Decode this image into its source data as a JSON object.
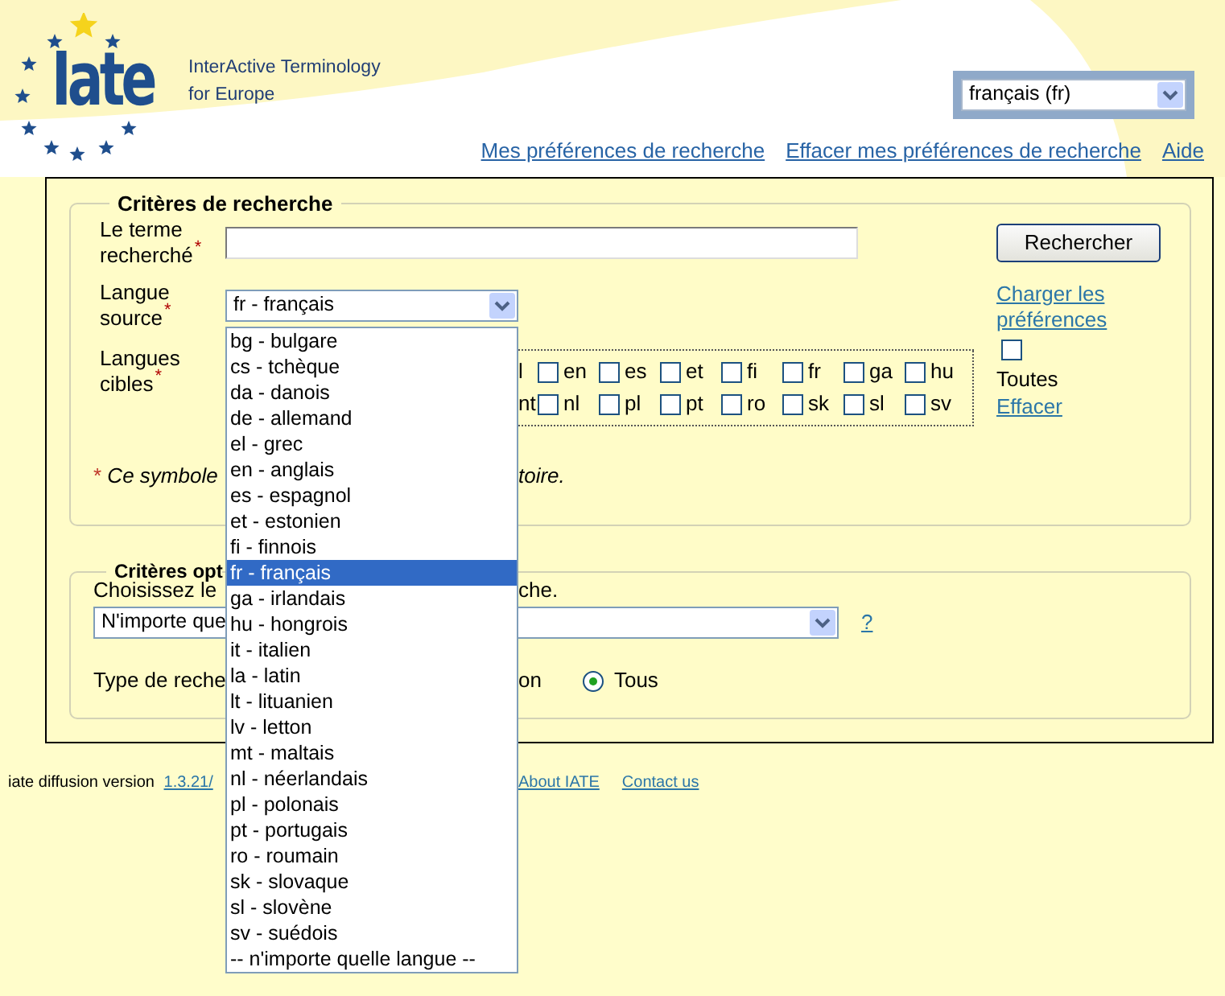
{
  "logo": {
    "mark": "Iate",
    "name_lines": [
      "InterActive Terminology",
      "for Europe"
    ]
  },
  "interface_language": {
    "value": "français (fr)"
  },
  "top_links": [
    "Mes préférences de recherche",
    "Effacer mes préférences de recherche",
    "Aide"
  ],
  "search_criteria": {
    "legend": "Critères de recherche",
    "term": {
      "label": "Le terme recherché",
      "mark": "*"
    },
    "search_button": "Rechercher",
    "source": {
      "label": "Langue source",
      "mark": "*",
      "value": "fr - français"
    },
    "load_link": "Charger les préférences",
    "targets": {
      "label": "Langues cibles",
      "mark": "*",
      "rows": [
        [
          {
            "kind": "text",
            "label": "l"
          },
          {
            "kind": "checkbox",
            "label": "en",
            "checked": false
          },
          {
            "kind": "checkbox",
            "label": "es",
            "checked": false
          },
          {
            "kind": "checkbox",
            "label": "et",
            "checked": false
          },
          {
            "kind": "checkbox",
            "label": "fi",
            "checked": false
          },
          {
            "kind": "checkbox",
            "label": "fr",
            "checked": false
          },
          {
            "kind": "checkbox",
            "label": "ga",
            "checked": false
          },
          {
            "kind": "checkbox",
            "label": "hu",
            "checked": false
          }
        ],
        [
          {
            "kind": "text",
            "label": "nt"
          },
          {
            "kind": "checkbox",
            "label": "nl",
            "checked": false
          },
          {
            "kind": "checkbox",
            "label": "pl",
            "checked": false
          },
          {
            "kind": "checkbox",
            "label": "pt",
            "checked": false
          },
          {
            "kind": "checkbox",
            "label": "ro",
            "checked": false
          },
          {
            "kind": "checkbox",
            "label": "sk",
            "checked": false
          },
          {
            "kind": "checkbox",
            "label": "sl",
            "checked": false
          },
          {
            "kind": "checkbox",
            "label": "sv",
            "checked": false
          }
        ]
      ]
    },
    "all": {
      "label": "Toutes",
      "checked": false
    },
    "clear_link": "Effacer",
    "footnote": {
      "mark": "*",
      "text": "Ce symbole",
      "tail": "toire."
    }
  },
  "options": {
    "legend": "Critères opt",
    "hint": "Choisissez le",
    "hint_tail": "che.",
    "select_value": "N'importe que",
    "help": "?",
    "type_label": "Type de reche",
    "type_tail": "on",
    "radios": [
      {
        "label": "Tous",
        "selected": true
      }
    ]
  },
  "dropdown": {
    "items": [
      {
        "label": "bg - bulgare",
        "selected": false
      },
      {
        "label": "cs - tchèque",
        "selected": false
      },
      {
        "label": "da - danois",
        "selected": false
      },
      {
        "label": "de - allemand",
        "selected": false
      },
      {
        "label": "el - grec",
        "selected": false
      },
      {
        "label": "en - anglais",
        "selected": false
      },
      {
        "label": "es - espagnol",
        "selected": false
      },
      {
        "label": "et - estonien",
        "selected": false
      },
      {
        "label": "fi - finnois",
        "selected": false
      },
      {
        "label": "fr - français",
        "selected": true
      },
      {
        "label": "ga - irlandais",
        "selected": false
      },
      {
        "label": "hu - hongrois",
        "selected": false
      },
      {
        "label": "it - italien",
        "selected": false
      },
      {
        "label": "la - latin",
        "selected": false
      },
      {
        "label": "lt - lituanien",
        "selected": false
      },
      {
        "label": "lv - letton",
        "selected": false
      },
      {
        "label": "mt - maltais",
        "selected": false
      },
      {
        "label": "nl - néerlandais",
        "selected": false
      },
      {
        "label": "pl - polonais",
        "selected": false
      },
      {
        "label": "pt - portugais",
        "selected": false
      },
      {
        "label": "ro - roumain",
        "selected": false
      },
      {
        "label": "sk - slovaque",
        "selected": false
      },
      {
        "label": "sl - slovène",
        "selected": false
      },
      {
        "label": "sv - suédois",
        "selected": false
      },
      {
        "label": "-- n'importe quelle langue --",
        "selected": false
      }
    ]
  },
  "footer": {
    "text": "iate diffusion version",
    "version_link": "1.3.21/",
    "links": [
      "About IATE",
      "Contact us"
    ]
  }
}
